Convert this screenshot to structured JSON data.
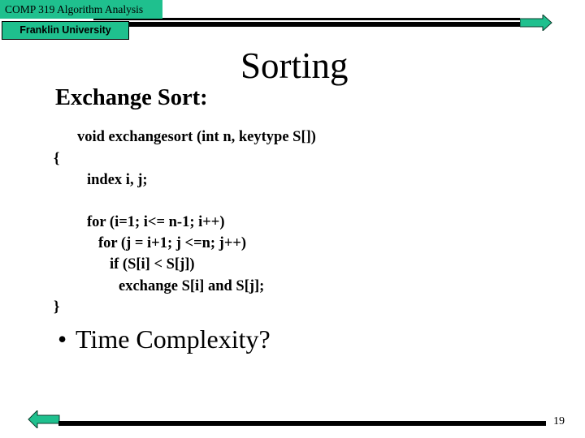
{
  "header": {
    "course": "COMP 319 Algorithm Analysis",
    "school": "Franklin University",
    "next_arrow_icon": "arrow-right-icon"
  },
  "slide": {
    "title": "Sorting",
    "heading": "Exchange Sort:",
    "code": [
      "void exchangesort (int n, keytype S[])",
      "{",
      "index i, j;",
      "for (i=1; i<= n-1; i++)",
      "for (j = i+1; j <=n; j++)",
      "if (S[i] < S[j])",
      "exchange S[i] and S[j];",
      "}"
    ],
    "bullets": [
      "Time Complexity?"
    ]
  },
  "footer": {
    "prev_arrow_icon": "arrow-left-icon",
    "page_number": "19"
  },
  "colors": {
    "accent": "#1fc08e",
    "bar": "#000000",
    "background": "#ffffff"
  }
}
